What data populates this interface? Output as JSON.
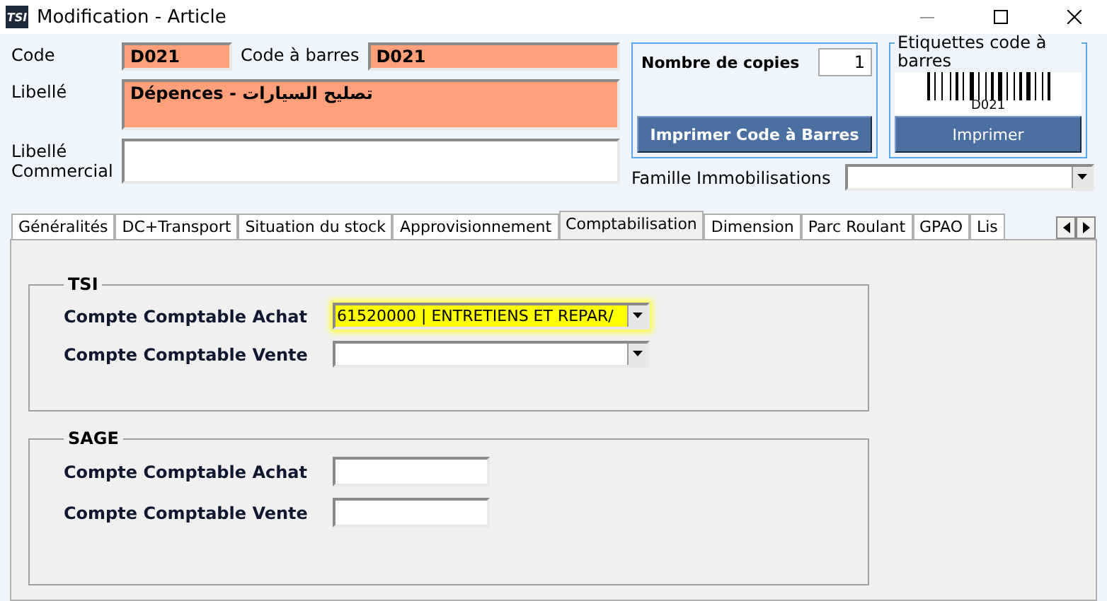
{
  "window": {
    "title": "Modification - Article",
    "app_icon": "TSI"
  },
  "fields": {
    "code_label": "Code",
    "code": "D021",
    "barcode_label": "Code à barres",
    "barcode": "D021",
    "libelle_label": "Libellé",
    "libelle": "Dépences - تصليح السيارات",
    "libelle_commercial_label": "Libellé Commercial"
  },
  "copies": {
    "label": "Nombre de copies",
    "value": "1",
    "button": "Imprimer Code à Barres"
  },
  "labels_panel": {
    "title": "Etiquettes code à barres",
    "caption": "D021",
    "button": "Imprimer"
  },
  "famille": {
    "label": "Famille Immobilisations"
  },
  "tabs": [
    {
      "label": "Généralités",
      "selected": false
    },
    {
      "label": "DC+Transport",
      "selected": false
    },
    {
      "label": "Situation du stock",
      "selected": false
    },
    {
      "label": "Approvisionnement",
      "selected": false
    },
    {
      "label": "Comptabilisation",
      "selected": true
    },
    {
      "label": "Dimension",
      "selected": false
    },
    {
      "label": "Parc Roulant",
      "selected": false
    },
    {
      "label": "GPAO",
      "selected": false
    },
    {
      "label": "Lis",
      "selected": false
    }
  ],
  "groups": [
    {
      "title": "TSI",
      "rows": [
        {
          "label": "Compte Comptable Achat",
          "kind": "combo",
          "value": "61520000 | ENTRETIENS ET REPAR/",
          "highlighted": true
        },
        {
          "label": "Compte Comptable Vente",
          "kind": "combo",
          "value": "",
          "highlighted": false
        }
      ]
    },
    {
      "title": "SAGE",
      "rows": [
        {
          "label": "Compte Comptable Achat",
          "kind": "text",
          "value": "",
          "highlighted": false
        },
        {
          "label": "Compte Comptable Vente",
          "kind": "text",
          "value": "",
          "highlighted": false
        }
      ]
    }
  ]
}
